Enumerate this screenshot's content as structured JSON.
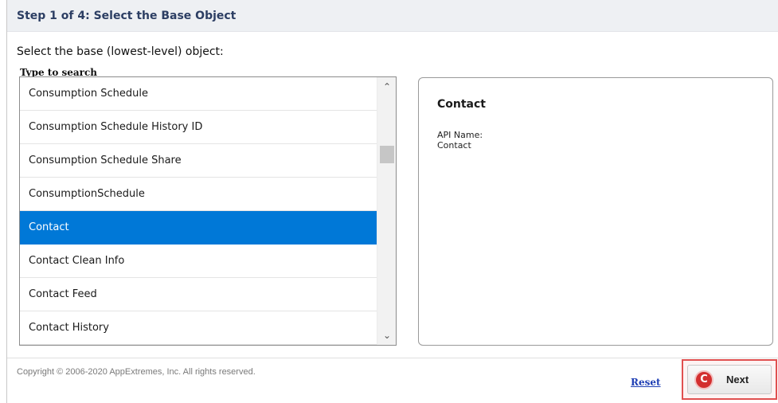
{
  "header": {
    "step_title": "Step 1 of 4: Select the Base Object"
  },
  "instruction": "Select the base (lowest-level) object:",
  "search": {
    "label": "Type to search"
  },
  "object_list": {
    "items": [
      {
        "label": "Consumption Schedule",
        "selected": false
      },
      {
        "label": "Consumption Schedule History ID",
        "selected": false
      },
      {
        "label": "Consumption Schedule Share",
        "selected": false
      },
      {
        "label": "ConsumptionSchedule",
        "selected": false
      },
      {
        "label": "Contact",
        "selected": true
      },
      {
        "label": "Contact Clean Info",
        "selected": false
      },
      {
        "label": "Contact Feed",
        "selected": false
      },
      {
        "label": "Contact History",
        "selected": false
      }
    ],
    "scroll_up_icon": "chevron-up-icon",
    "scroll_down_icon": "chevron-down-icon"
  },
  "detail": {
    "title": "Contact",
    "api_name_label": "API Name:",
    "api_name_value": "Contact"
  },
  "footer": {
    "copyright": "Copyright © 2006-2020 AppExtremes, Inc. All rights reserved.",
    "reset_label": "Reset",
    "next_label": "Next",
    "next_icon": "conga-logo-icon",
    "next_icon_glyph": "C"
  },
  "colors": {
    "selected_row": "#0078d7",
    "header_background": "#eef0f3",
    "link": "#1f3fb4",
    "next_highlight_border": "#e05050",
    "next_icon": "#d32f2f"
  }
}
